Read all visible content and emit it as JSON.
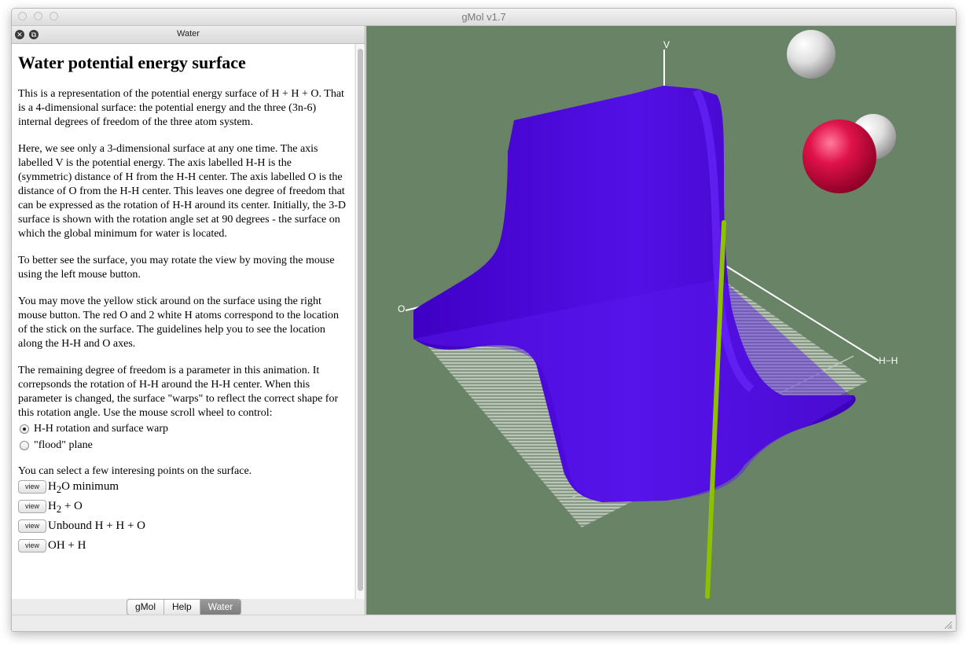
{
  "window": {
    "title": "gMol v1.7"
  },
  "panel": {
    "title": "Water",
    "close_icon": "close-icon",
    "detach_icon": "detach-icon"
  },
  "doc": {
    "heading": "Water potential energy surface",
    "p1": "This is a representation of the potential energy surface of H + H + O. That is a 4-dimensional surface: the potential energy and the three (3n-6) internal degrees of freedom of the three atom system.",
    "p2": "Here, we see only a 3-dimensional surface at any one time. The axis labelled V is the potential energy. The axis labelled H-H is the (symmetric) distance of H from the H-H center. The axis labelled O is the distance of O from the H-H center. This leaves one degree of freedom that can be expressed as the rotation of H-H around its center. Initially, the 3-D surface is shown with the rotation angle set at 90 degrees - the surface on which the global minimum for water is located.",
    "p3": "To better see the surface, you may rotate the view by moving the mouse using the left mouse button.",
    "p4": "You may move the yellow stick around on the surface using the right mouse button. The red O and 2 white H atoms correspond to the location of the stick on the surface. The guidelines help you to see the location along the H-H and O axes.",
    "p5": "The remaining degree of freedom is a parameter in this animation. It correpsonds the rotation of H-H around the H-H center. When this parameter is changed, the surface \"warps\" to reflect the correct shape for this rotation angle. Use the mouse scroll wheel to control:",
    "radio_options": [
      {
        "label": "H-H rotation and surface warp",
        "checked": true
      },
      {
        "label": "\"flood\" plane",
        "checked": false
      }
    ],
    "points_intro": "You can select a few interesing points on the surface.",
    "view_button_label": "view",
    "points": [
      {
        "pre": "H",
        "sub": "2",
        "post": "O minimum"
      },
      {
        "pre": "H",
        "sub": "2",
        "post": " + O"
      },
      {
        "pre": "Unbound H + H + O",
        "sub": "",
        "post": ""
      },
      {
        "pre": "OH + H",
        "sub": "",
        "post": ""
      }
    ]
  },
  "tabs": [
    {
      "label": "gMol",
      "active": false
    },
    {
      "label": "Help",
      "active": false
    },
    {
      "label": "Water",
      "active": true
    }
  ],
  "viewport": {
    "background_color": "#688366",
    "surface_color": "#4a00d8",
    "stick_color": "#8cc000",
    "oxygen_color": "#e0124a",
    "hydrogen_color": "#e8e8e8",
    "axis_labels": {
      "v": "V",
      "o": "O",
      "hh": "H−H"
    }
  }
}
